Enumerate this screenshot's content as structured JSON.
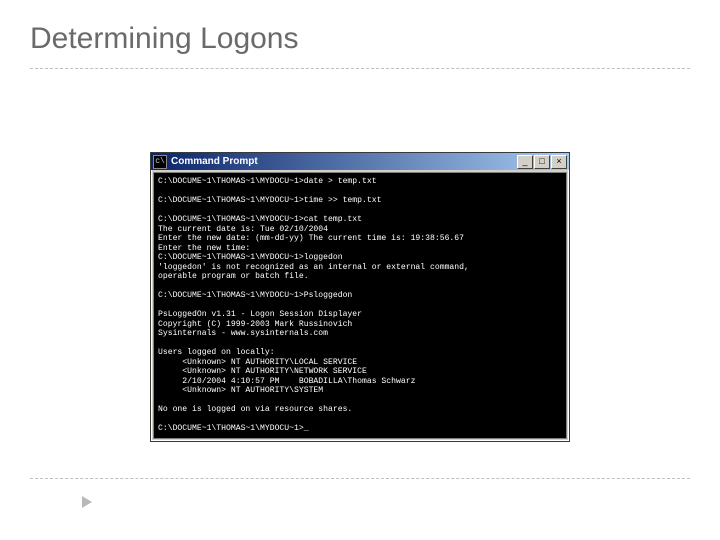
{
  "slide": {
    "title": "Determining Logons",
    "bullet_placeholder": ""
  },
  "window": {
    "icon_glyph": "c\\",
    "title": "Command Prompt",
    "buttons": {
      "min": "_",
      "max": "□",
      "close": "×"
    }
  },
  "terminal_text": "C:\\DOCUME~1\\THOMAS~1\\MYDOCU~1>date > temp.txt\n\nC:\\DOCUME~1\\THOMAS~1\\MYDOCU~1>time >> temp.txt\n\nC:\\DOCUME~1\\THOMAS~1\\MYDOCU~1>cat temp.txt\nThe current date is: Tue 02/10/2004\nEnter the new date: (mm-dd-yy) The current time is: 19:38:56.67\nEnter the new time:\nC:\\DOCUME~1\\THOMAS~1\\MYDOCU~1>loggedon\n'loggedon' is not recognized as an internal or external command,\noperable program or batch file.\n\nC:\\DOCUME~1\\THOMAS~1\\MYDOCU~1>Psloggedon\n\nPsLoggedOn v1.31 - Logon Session Displayer\nCopyright (C) 1999-2003 Mark Russinovich\nSysinternals - www.sysinternals.com\n\nUsers logged on locally:\n     <Unknown> NT AUTHORITY\\LOCAL SERVICE\n     <Unknown> NT AUTHORITY\\NETWORK SERVICE\n     2/10/2004 4:10:57 PM    BOBADILLA\\Thomas Schwarz\n     <Unknown> NT AUTHORITY\\SYSTEM\n\nNo one is logged on via resource shares.\n\nC:\\DOCUME~1\\THOMAS~1\\MYDOCU~1>_"
}
